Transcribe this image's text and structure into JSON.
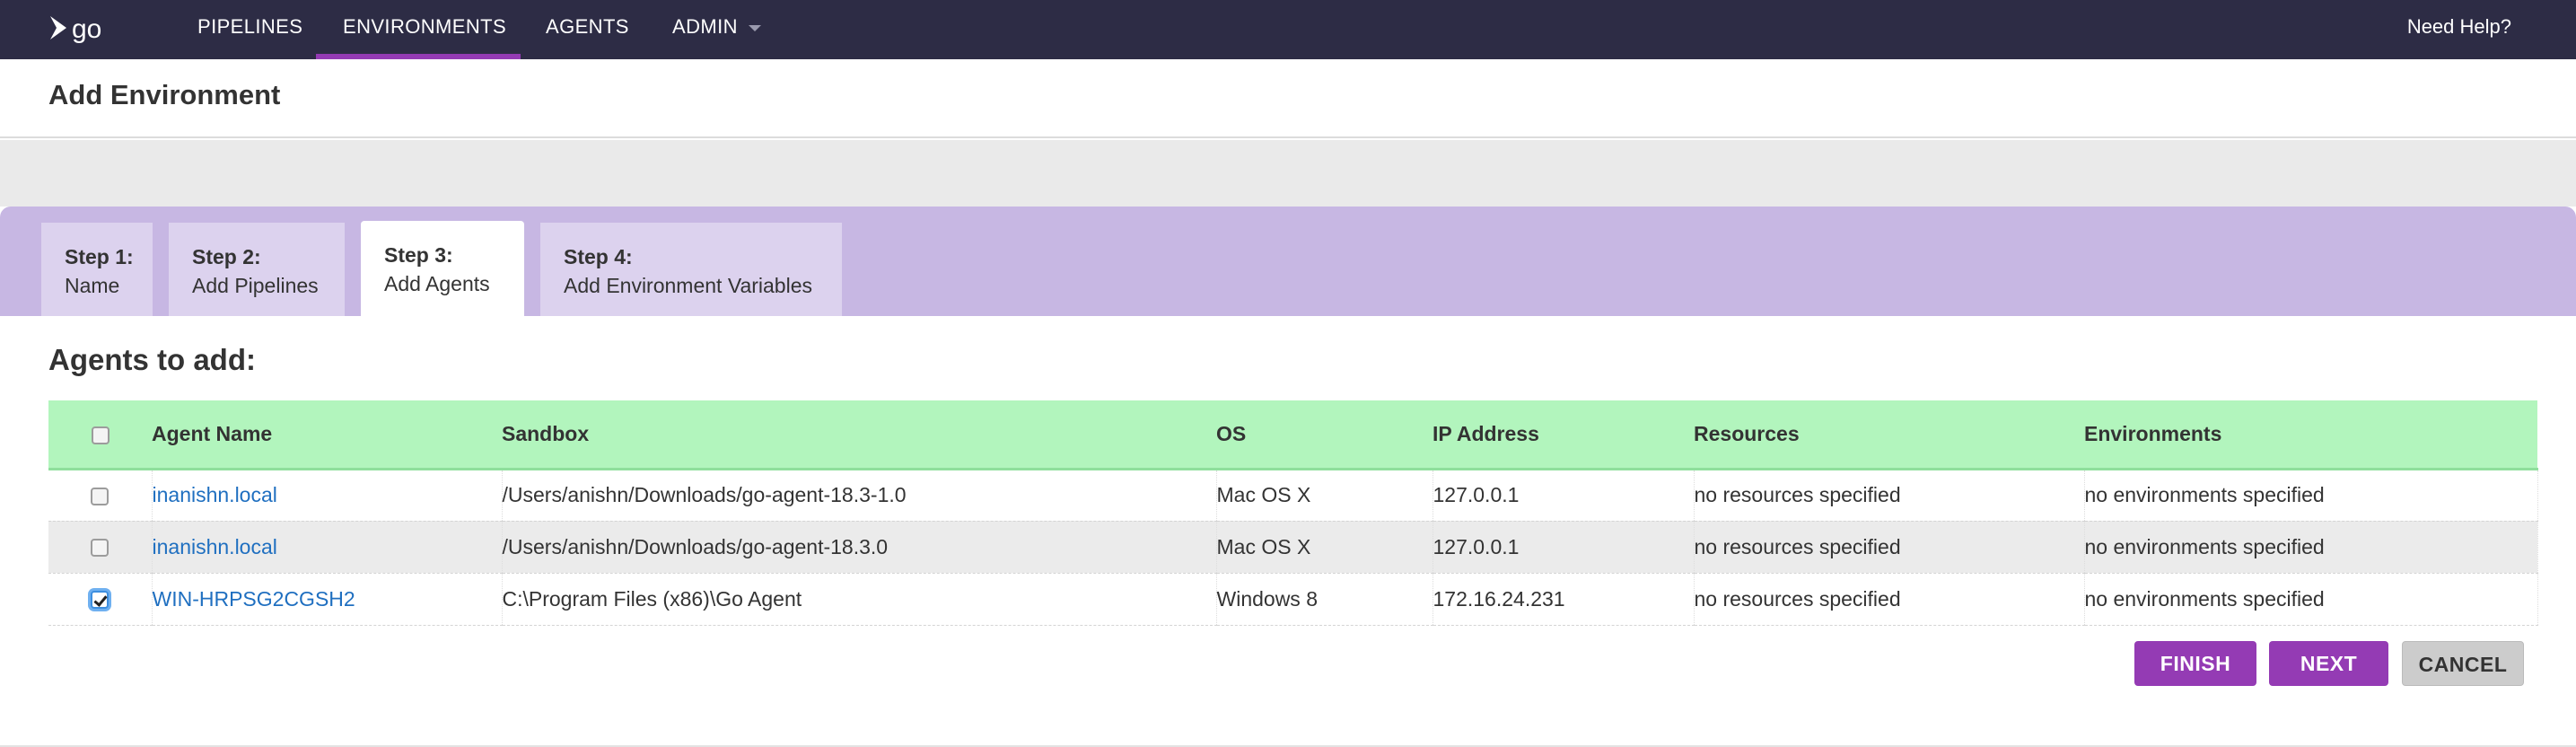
{
  "nav": {
    "logo_text": "go",
    "items": [
      {
        "label": "PIPELINES"
      },
      {
        "label": "ENVIRONMENTS"
      },
      {
        "label": "AGENTS"
      },
      {
        "label": "ADMIN"
      }
    ],
    "help_label": "Need Help?"
  },
  "page": {
    "title": "Add Environment"
  },
  "steps": [
    {
      "number": "Step 1:",
      "label": "Name"
    },
    {
      "number": "Step 2:",
      "label": "Add Pipelines"
    },
    {
      "number": "Step 3:",
      "label": "Add Agents"
    },
    {
      "number": "Step 4:",
      "label": "Add Environment Variables"
    }
  ],
  "current_step": 3,
  "agents_section": {
    "title": "Agents to add:",
    "columns": [
      "Agent Name",
      "Sandbox",
      "OS",
      "IP Address",
      "Resources",
      "Environments"
    ],
    "rows": [
      {
        "checked": false,
        "name": "inanishn.local",
        "sandbox": "/Users/anishn/Downloads/go-agent-18.3-1.0",
        "os": "Mac OS X",
        "ip": "127.0.0.1",
        "resources": "no resources specified",
        "environments": "no environments specified"
      },
      {
        "checked": false,
        "name": "inanishn.local",
        "sandbox": "/Users/anishn/Downloads/go-agent-18.3.0",
        "os": "Mac OS X",
        "ip": "127.0.0.1",
        "resources": "no resources specified",
        "environments": "no environments specified"
      },
      {
        "checked": true,
        "name": "WIN-HRPSG2CGSH2",
        "sandbox": "C:\\Program Files (x86)\\Go Agent",
        "os": "Windows 8",
        "ip": "172.16.24.231",
        "resources": "no resources specified",
        "environments": "no environments specified"
      }
    ]
  },
  "buttons": {
    "finish": "FINISH",
    "next": "NEXT",
    "cancel": "CANCEL"
  },
  "colors": {
    "nav_background": "#2d2c45",
    "accent_purple": "#943bb4",
    "steps_bar": "#c7b7e3",
    "table_header": "#b2f5bd",
    "link": "#1f6fc0"
  }
}
